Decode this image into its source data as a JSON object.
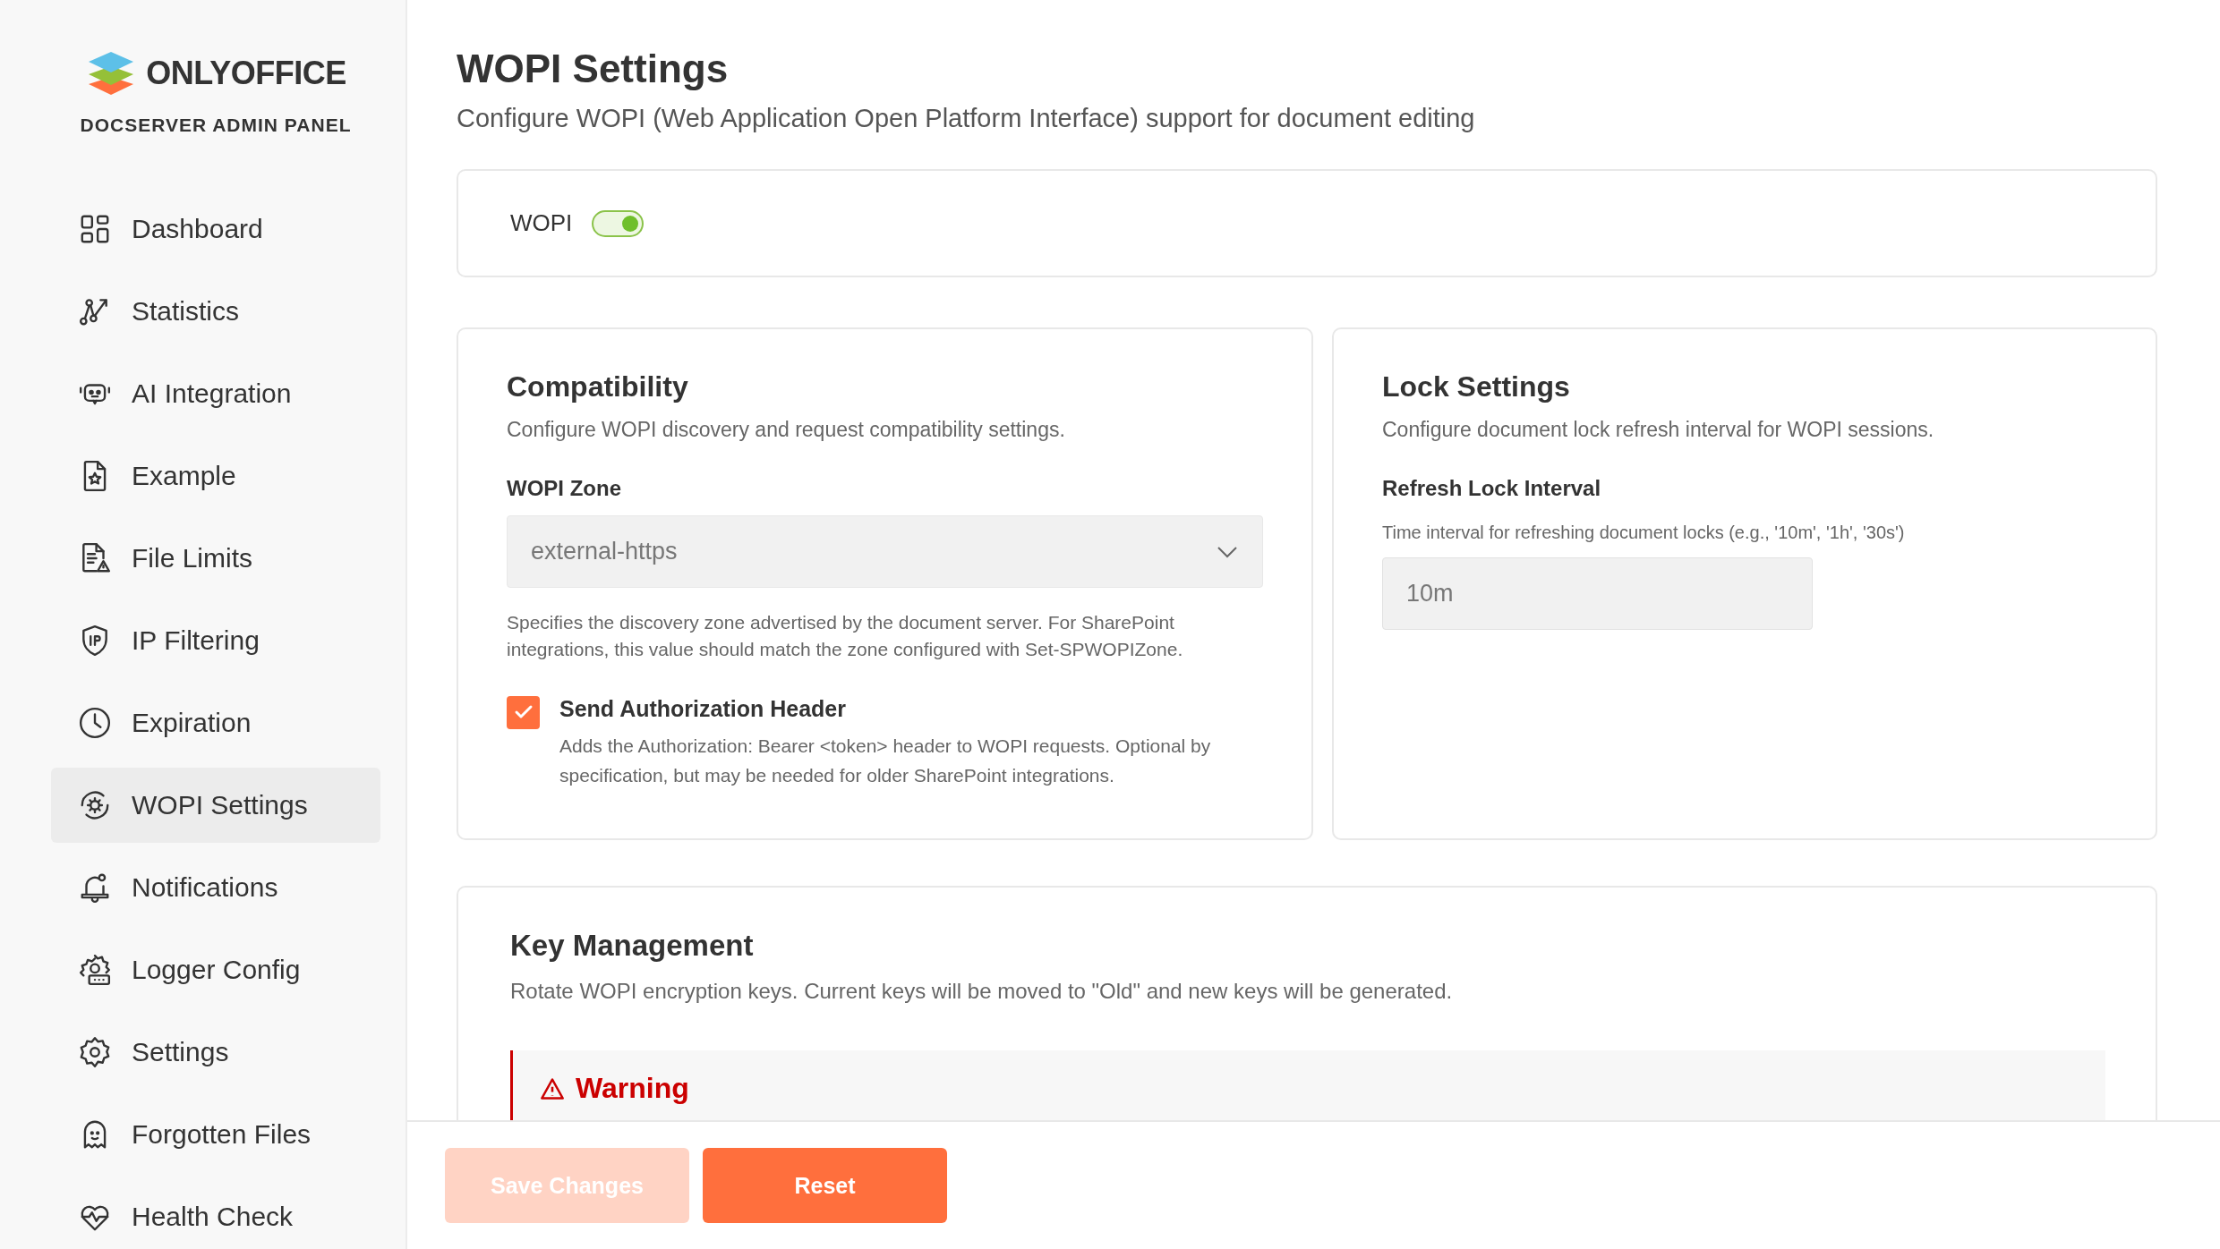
{
  "logo": {
    "brand": "ONLYOFFICE",
    "subtitle": "DOCSERVER ADMIN PANEL"
  },
  "sidebar": {
    "items": [
      {
        "label": "Dashboard",
        "selected": false
      },
      {
        "label": "Statistics",
        "selected": false
      },
      {
        "label": "AI Integration",
        "selected": false
      },
      {
        "label": "Example",
        "selected": false
      },
      {
        "label": "File Limits",
        "selected": false
      },
      {
        "label": "IP Filtering",
        "selected": false
      },
      {
        "label": "Expiration",
        "selected": false
      },
      {
        "label": "WOPI Settings",
        "selected": true
      },
      {
        "label": "Notifications",
        "selected": false
      },
      {
        "label": "Logger Config",
        "selected": false
      },
      {
        "label": "Settings",
        "selected": false
      },
      {
        "label": "Forgotten Files",
        "selected": false
      },
      {
        "label": "Health Check",
        "selected": false
      }
    ]
  },
  "page": {
    "title": "WOPI Settings",
    "subtitle": "Configure WOPI (Web Application Open Platform Interface) support for document editing"
  },
  "wopi_toggle": {
    "label": "WOPI",
    "on": true
  },
  "compatibility": {
    "title": "Compatibility",
    "description": "Configure WOPI discovery and request compatibility settings.",
    "zone_label": "WOPI Zone",
    "zone_value": "external-https",
    "zone_help": "Specifies the discovery zone advertised by the document server. For SharePoint integrations, this value should match the zone configured with Set-SPWOPIZone.",
    "auth_checkbox": {
      "label": "Send Authorization Header",
      "description": "Adds the Authorization: Bearer <token> header to WOPI requests. Optional by specification, but may be needed for older SharePoint integrations.",
      "checked": true
    }
  },
  "lock": {
    "title": "Lock Settings",
    "description": "Configure document lock refresh interval for WOPI sessions.",
    "field_label": "Refresh Lock Interval",
    "field_hint": "Time interval for refreshing document locks (e.g., '10m', '1h', '30s')",
    "field_value": "10m"
  },
  "key_management": {
    "title": "Key Management",
    "description": "Rotate WOPI encryption keys. Current keys will be moved to \"Old\" and new keys will be generated.",
    "warning": {
      "title": "Warning"
    }
  },
  "footer": {
    "buttons": [
      {
        "label": "Save Changes",
        "disabled": true
      },
      {
        "label": "Reset",
        "disabled": false
      }
    ]
  }
}
